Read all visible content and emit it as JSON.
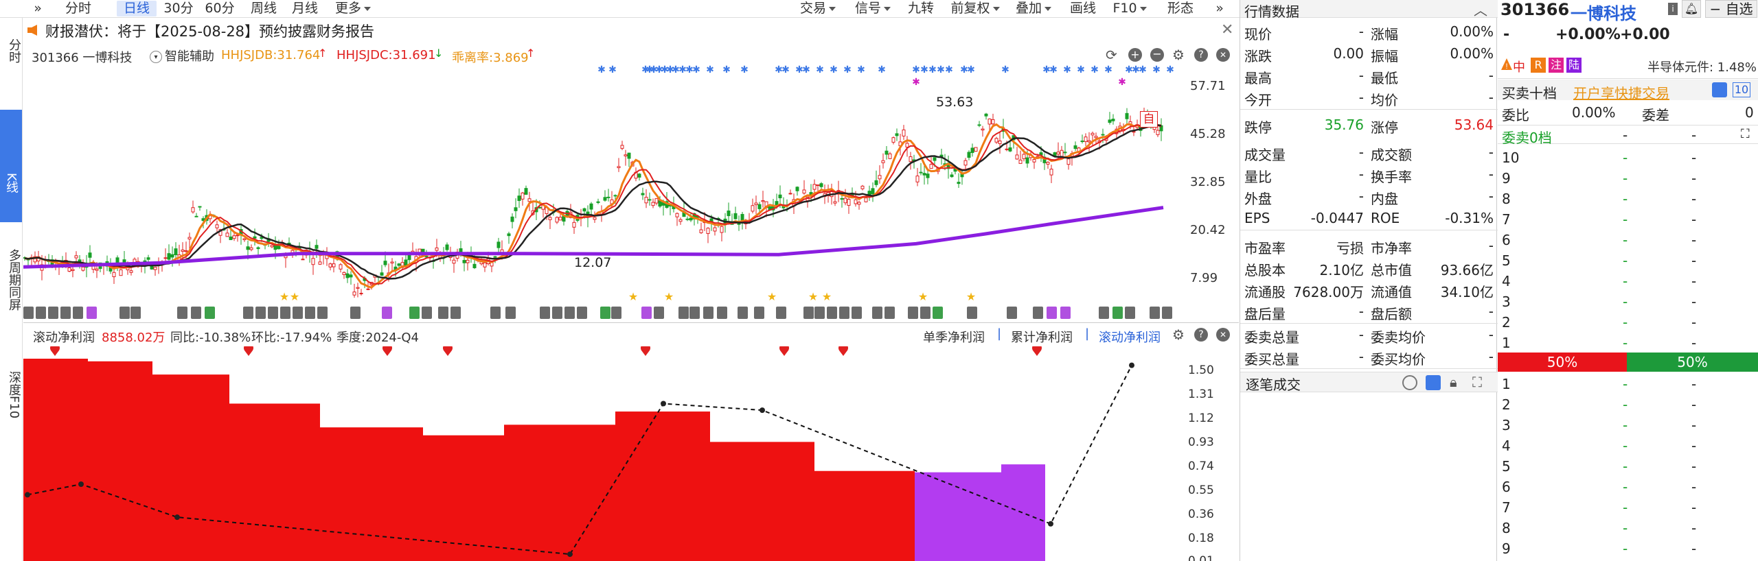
{
  "toolbar": {
    "items": [
      "分时",
      "日线",
      "30分",
      "60分",
      "周线",
      "月线",
      "更多"
    ],
    "right_items": [
      "交易",
      "信号",
      "九转",
      "前复权",
      "叠加",
      "画线",
      "F10",
      "形态"
    ]
  },
  "side_tabs": [
    "分时",
    "K线",
    "多周期同屏",
    "深度F10"
  ],
  "notice": "财报潜伏：将于【2025-08-28】预约披露财务报告",
  "chart_header": {
    "code_name": "301366 一博科技",
    "assist": "智能辅助",
    "hhjsjdb": "HHJSJDB:31.764",
    "hhjsjdc": "HHJSJDC:31.691",
    "ratio": "乖离率:3.869",
    "self_tag": "自"
  },
  "price_axis": [
    "57.71",
    "45.28",
    "32.85",
    "20.42",
    "7.99"
  ],
  "high_label": "53.63",
  "low_label": "12.07",
  "bottom_header": {
    "title": "滚动净利润",
    "value": "8858.02万",
    "yoy": "同比:-10.38%",
    "qoq": "环比:-17.94%",
    "season": "季度:2024-Q4",
    "tabs": [
      "单季净利润",
      "累计净利润",
      "滚动净利润"
    ]
  },
  "bottom_axis": [
    "1.50",
    "1.31",
    "1.12",
    "0.93",
    "0.74",
    "0.55",
    "0.36",
    "0.18",
    "0.01"
  ],
  "quote": {
    "title": "行情数据",
    "rows": [
      [
        "现价",
        "-",
        "涨幅",
        "0.00%"
      ],
      [
        "涨跌",
        "0.00",
        "振幅",
        "0.00%"
      ],
      [
        "最高",
        "-",
        "最低",
        "-"
      ],
      [
        "今开",
        "-",
        "均价",
        "-"
      ],
      [
        "跌停",
        "35.76",
        "涨停",
        "53.64"
      ],
      [
        "成交量",
        "-",
        "成交额",
        "-"
      ],
      [
        "量比",
        "-",
        "换手率",
        "-"
      ],
      [
        "外盘",
        "-",
        "内盘",
        "-"
      ],
      [
        "EPS",
        "-0.0447",
        "ROE",
        "-0.31%"
      ],
      [
        "市盈率",
        "亏损",
        "市净率",
        "-"
      ],
      [
        "总股本",
        "2.10亿",
        "总市值",
        "93.66亿"
      ],
      [
        "流通股",
        "7628.00万",
        "流通值",
        "34.10亿"
      ],
      [
        "盘后量",
        "-",
        "盘后额",
        "-"
      ],
      [
        "委卖总量",
        "-",
        "委卖均价",
        "-"
      ],
      [
        "委买总量",
        "-",
        "委买均价",
        "-"
      ]
    ],
    "trade_ticks": "逐笔成交"
  },
  "book": {
    "code": "301366",
    "name": "一博科技",
    "watch": "自选",
    "price": "-",
    "change": "+0.00%",
    "change_abs": "+0.00",
    "tags": [
      "中",
      "R",
      "注",
      "陆"
    ],
    "sector": "半导体元件: 1.48%",
    "ten_level": "买卖十档",
    "open_trade": "开户享快捷交易",
    "level_badge": "10",
    "weibi_label": "委比",
    "weibi": "0.00%",
    "weicha_label": "委差",
    "weicha": "0",
    "sell0": "委卖0档",
    "sell_levels": [
      "10",
      "9",
      "8",
      "7",
      "6",
      "5",
      "4",
      "3",
      "2",
      "1"
    ],
    "buy_levels": [
      "1",
      "2",
      "3",
      "4",
      "5",
      "6",
      "7",
      "8",
      "9"
    ],
    "left_pct": "50%",
    "right_pct": "50%"
  },
  "chart_data": [
    {
      "type": "bar",
      "title": "滚动净利润",
      "ylim": [
        0.01,
        1.5
      ],
      "values": [
        1.5,
        1.48,
        1.38,
        1.16,
        0.98,
        0.92,
        1.0,
        1.1,
        0.87,
        0.65,
        0.64,
        0.7
      ],
      "line": [
        0.47,
        0.55,
        0.3,
        null,
        null,
        0.02,
        1.16,
        1.11,
        null,
        null,
        0.25,
        1.45
      ]
    }
  ]
}
